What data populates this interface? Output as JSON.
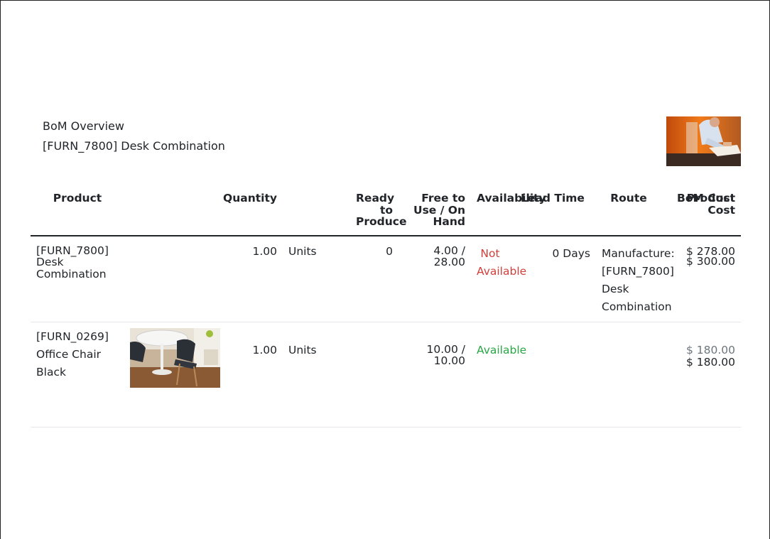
{
  "report": {
    "title": "BoM Overview",
    "subtitle": "[FURN_7800] Desk Combination"
  },
  "columns": {
    "product": "Product",
    "quantity": "Quantity",
    "ready_to_produce": "Ready to Produce",
    "free_on_hand": "Free to Use / On Hand",
    "availability": "Availability",
    "lead_time": "Lead Time",
    "route": "Route",
    "bom_cost": "BoM Cost",
    "product_cost": "Product Cost"
  },
  "rows": [
    {
      "product": "[FURN_7800] Desk Combination",
      "quantity": "1.00",
      "uom": "Units",
      "ready_to_produce": "0",
      "free_on_hand": "4.00 / 28.00",
      "availability": "Not Available",
      "lead_time": "0 Days",
      "route": "Manufacture: [FURN_7800] Desk Combination",
      "bom_cost": "$ 278.00",
      "product_cost": "$ 300.00"
    },
    {
      "product": "[FURN_0269] Office Chair Black",
      "quantity": "1.00",
      "uom": "Units",
      "free_on_hand": "10.00 / 10.00",
      "availability": "Available",
      "bom_cost": "$ 180.00",
      "product_cost": "$ 180.00"
    }
  ],
  "colors": {
    "not_available": "#d23f3a",
    "available": "#28a745",
    "muted_cost": "#6c757d"
  }
}
